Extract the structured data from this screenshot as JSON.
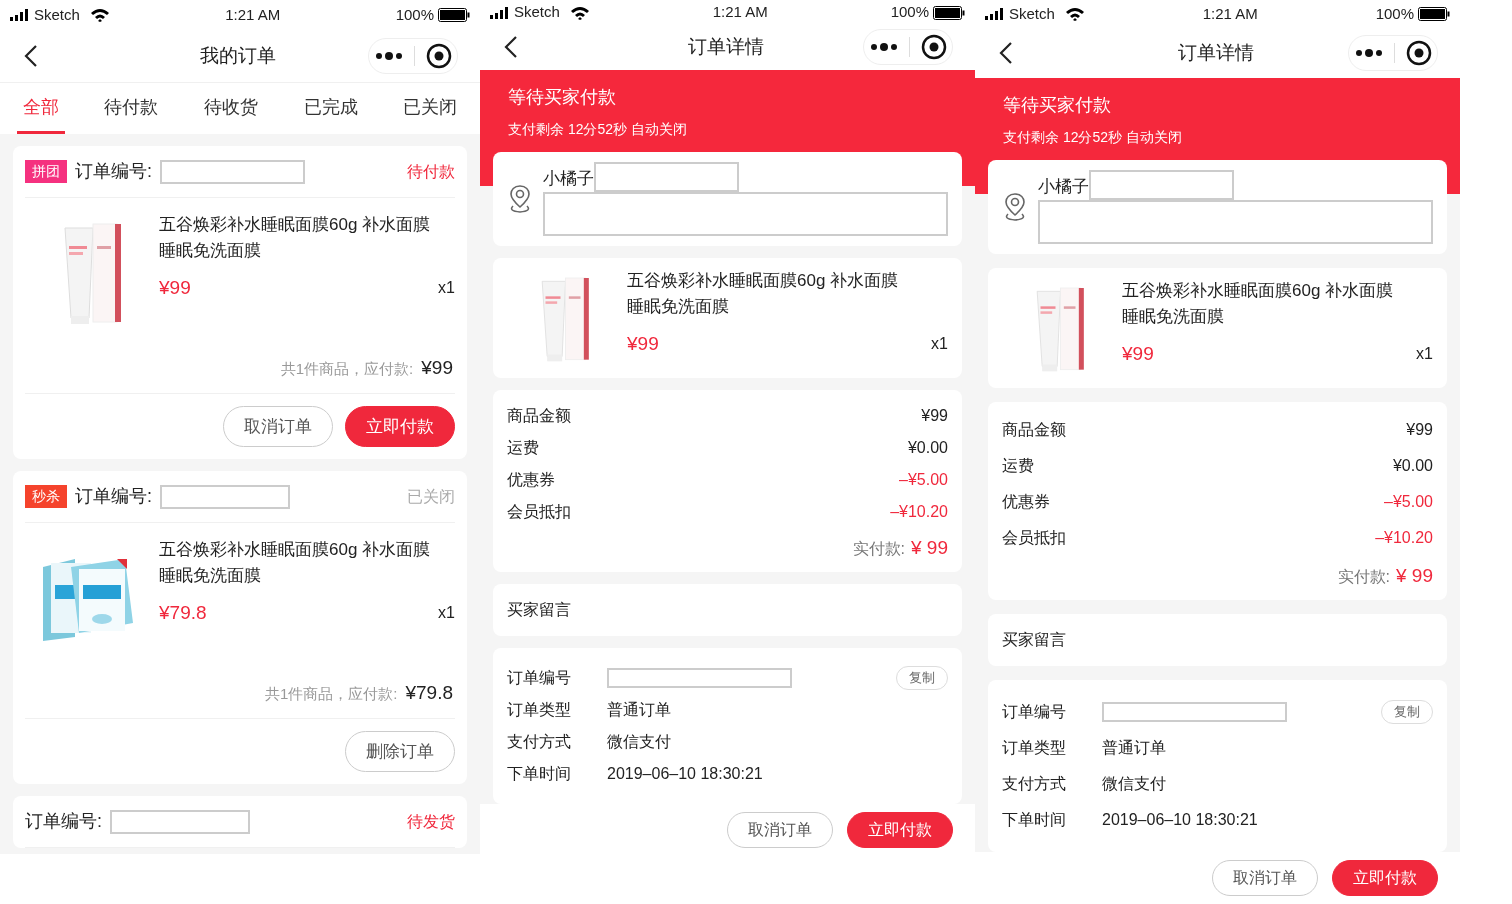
{
  "screens": [
    {
      "kind": "order_list",
      "status_bar": {
        "carrier": "Sketch",
        "time": "1:21 AM",
        "battery": "100%"
      },
      "title": "我的订单",
      "tabs": [
        {
          "label": "全部",
          "selected": true
        },
        {
          "label": "待付款",
          "selected": false
        },
        {
          "label": "待收货",
          "selected": false
        },
        {
          "label": "已完成",
          "selected": false
        },
        {
          "label": "已关闭",
          "selected": false
        }
      ],
      "orders": [
        {
          "tag": {
            "text": "拼团",
            "color": "#f5317f"
          },
          "number_label": "订单编号:",
          "status": "待付款",
          "closed": false,
          "item": {
            "title": "五谷焕彩补水睡眠面膜60g 补水面膜睡眠免洗面膜",
            "price": "¥99",
            "quantity": "x1"
          },
          "summary_label": "共1件商品，应付款:",
          "total": "¥99",
          "buttons": [
            {
              "label": "取消订单",
              "primary": false
            },
            {
              "label": "立即付款",
              "primary": true
            }
          ]
        },
        {
          "tag": {
            "text": "秒杀",
            "color": "#f5432c"
          },
          "number_label": "订单编号:",
          "status": "已关闭",
          "closed": true,
          "item": {
            "title": "五谷焕彩补水睡眠面膜60g 补水面膜睡眠免洗面膜",
            "price": "¥79.8",
            "quantity": "x1"
          },
          "summary_label": "共1件商品，应付款:",
          "total": "¥79.8",
          "buttons": [
            {
              "label": "删除订单",
              "primary": false
            }
          ]
        },
        {
          "number_label": "订单编号:",
          "status": "待发货",
          "closed": false
        }
      ]
    },
    {
      "kind": "order_detail",
      "status_bar": {
        "carrier": "Sketch",
        "time": "1:21 AM",
        "battery": "100%"
      },
      "title": "订单详情",
      "banner": {
        "title": "等待买家付款",
        "countdown": "支付剩余 12分52秒 自动关闭"
      },
      "address": {
        "name": "小橘子"
      },
      "item": {
        "title": "五谷焕彩补水睡眠面膜60g 补水面膜睡眠免洗面膜",
        "price": "¥99",
        "quantity": "x1"
      },
      "amounts": [
        {
          "label": "商品金额",
          "value": "¥99",
          "negative": false
        },
        {
          "label": "运费",
          "value": "¥0.00",
          "negative": false
        },
        {
          "label": "优惠券",
          "value": "–¥5.00",
          "negative": true
        },
        {
          "label": "会员抵扣",
          "value": "–¥10.20",
          "negative": true
        }
      ],
      "paid_label": "实付款:",
      "paid": "¥ 99",
      "message_label": "买家留言",
      "info": [
        {
          "label": "订单编号",
          "redacted": true,
          "action": "复制"
        },
        {
          "label": "订单类型",
          "value": "普通订单",
          "redacted": false
        },
        {
          "label": "支付方式",
          "value": "微信支付",
          "redacted": false
        },
        {
          "label": "下单时间",
          "value": "2019–06–10 18:30:21",
          "redacted": false
        }
      ],
      "buttons": [
        {
          "label": "取消订单",
          "primary": false
        },
        {
          "label": "立即付款",
          "primary": true
        }
      ]
    },
    {
      "kind": "order_detail",
      "status_bar": {
        "carrier": "Sketch",
        "time": "1:21 AM",
        "battery": "100%"
      },
      "title": "订单详情",
      "banner": {
        "title": "等待买家付款",
        "countdown": "支付剩余 12分52秒 自动关闭"
      },
      "address": {
        "name": "小橘子"
      },
      "item": {
        "title": "五谷焕彩补水睡眠面膜60g 补水面膜睡眠免洗面膜",
        "price": "¥99",
        "quantity": "x1"
      },
      "amounts": [
        {
          "label": "商品金额",
          "value": "¥99",
          "negative": false
        },
        {
          "label": "运费",
          "value": "¥0.00",
          "negative": false
        },
        {
          "label": "优惠券",
          "value": "–¥5.00",
          "negative": true
        },
        {
          "label": "会员抵扣",
          "value": "–¥10.20",
          "negative": true
        }
      ],
      "paid_label": "实付款:",
      "paid": "¥ 99",
      "message_label": "买家留言",
      "info": [
        {
          "label": "订单编号",
          "redacted": true,
          "action": "复制"
        },
        {
          "label": "订单类型",
          "value": "普通订单",
          "redacted": false
        },
        {
          "label": "支付方式",
          "value": "微信支付",
          "redacted": false
        },
        {
          "label": "下单时间",
          "value": "2019–06–10 18:30:21",
          "redacted": false
        }
      ],
      "buttons": [
        {
          "label": "取消订单",
          "primary": false
        },
        {
          "label": "立即付款",
          "primary": true
        }
      ]
    }
  ]
}
